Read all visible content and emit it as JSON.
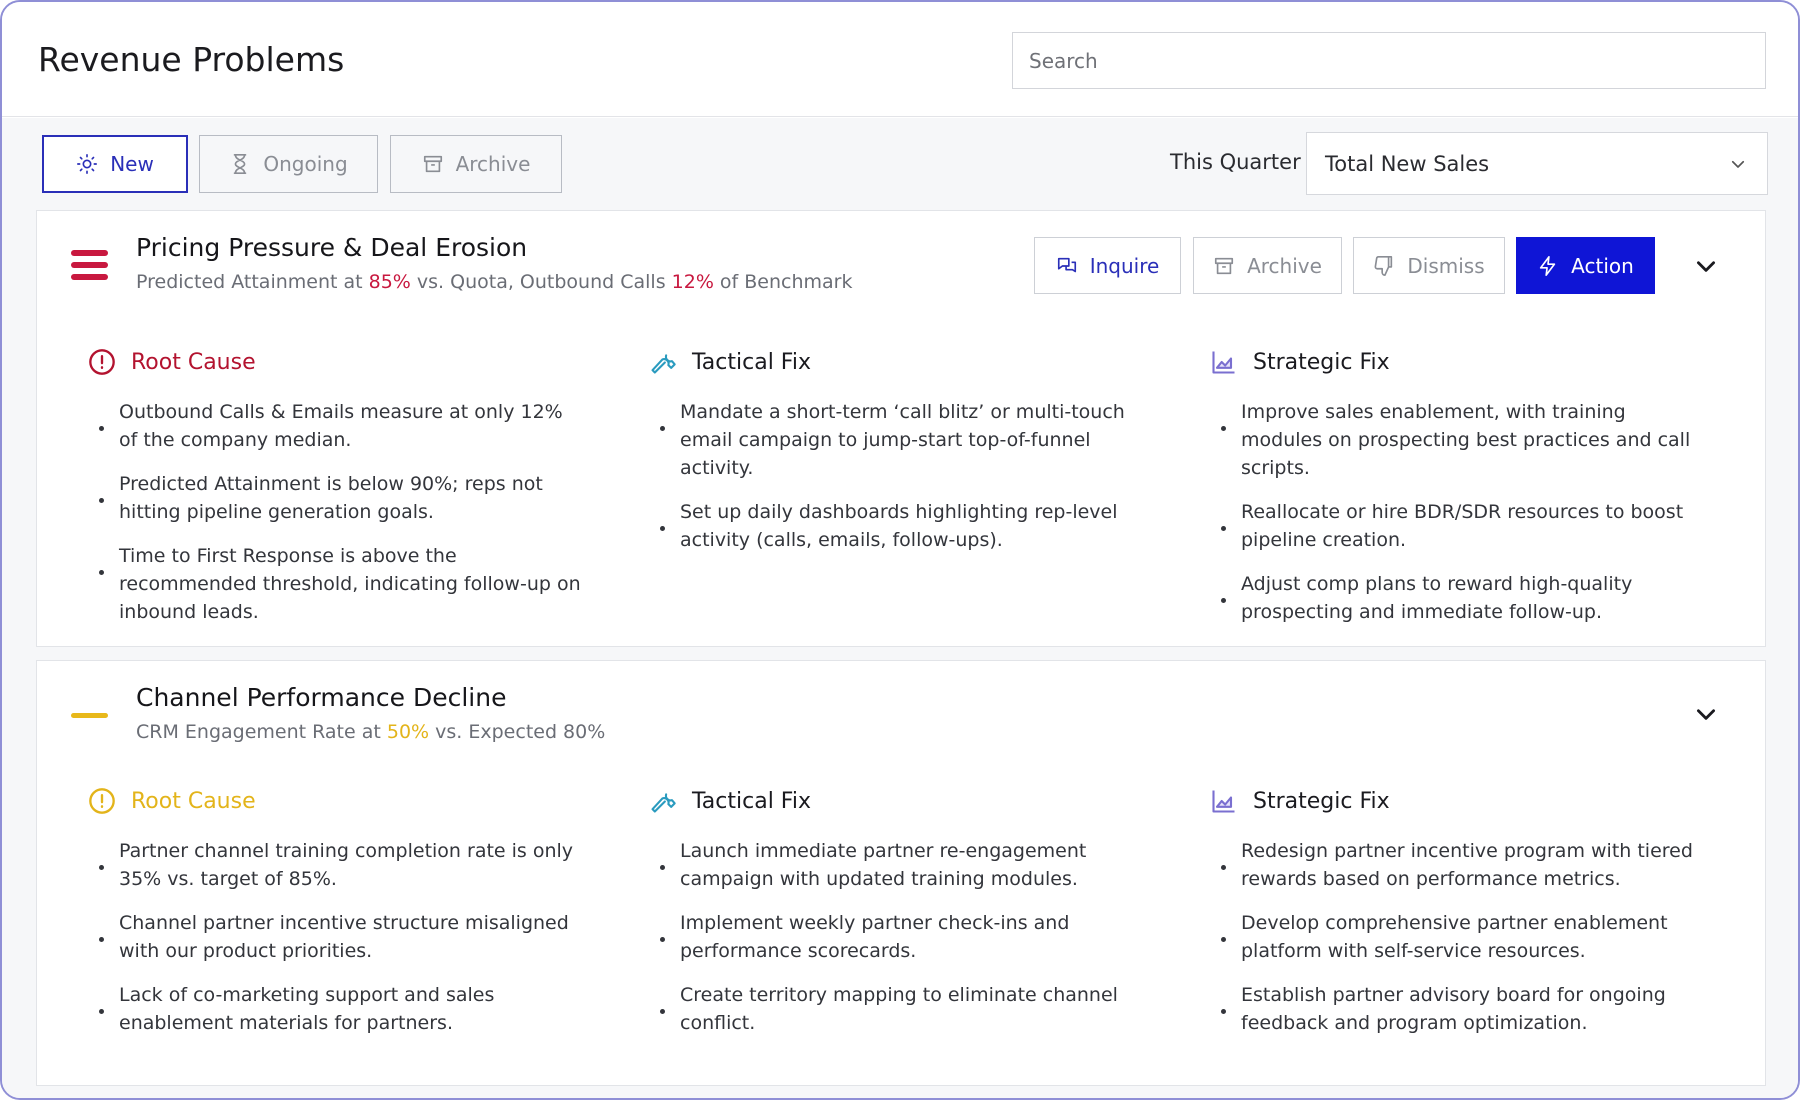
{
  "header": {
    "title": "Revenue Problems",
    "search_placeholder": "Search"
  },
  "tabs": [
    {
      "label": "New",
      "icon": "sun-icon",
      "active": true
    },
    {
      "label": "Ongoing",
      "icon": "hourglass-icon",
      "active": false
    },
    {
      "label": "Archive",
      "icon": "archive-icon",
      "active": false
    }
  ],
  "filters": {
    "period": "This Quarter",
    "metric_selected": "Total New Sales"
  },
  "colors": {
    "accent": "#0f15d6",
    "severity_high": "#c8183f",
    "severity_medium": "#e8b81a",
    "tactical_icon": "#2a9bbf",
    "strategic_icon": "#7a6fd0"
  },
  "problems": [
    {
      "severity": "high",
      "title": "Pricing Pressure & Deal Erosion",
      "subtitle": {
        "p1": "Predicted Attainment at ",
        "v1": "85%",
        "p2": " vs. Quota, Outbound Calls ",
        "v2": "12%",
        "p3": " of Benchmark"
      },
      "actions": {
        "inquire": "Inquire",
        "archive": "Archive",
        "dismiss": "Dismiss",
        "action": "Action"
      },
      "root_cause": {
        "title": "Root Cause",
        "items": [
          "Outbound Calls & Emails measure at only 12% of the company median.",
          "Predicted Attainment is below 90%; reps not hitting pipeline generation goals.",
          "Time to First Response is above the recommended threshold, indicating follow-up on inbound leads."
        ]
      },
      "tactical_fix": {
        "title": "Tactical Fix",
        "items": [
          "Mandate a short-term ‘call blitz’ or multi-touch email campaign to jump-start top-of-funnel activity.",
          "Set up daily dashboards highlighting rep-level activity (calls, emails, follow-ups)."
        ]
      },
      "strategic_fix": {
        "title": "Strategic Fix",
        "items": [
          "Improve sales enablement, with training modules on prospecting best practices and call scripts.",
          "Reallocate or hire BDR/SDR resources to boost pipeline creation.",
          "Adjust comp plans to reward high-quality prospecting and immediate follow-up."
        ]
      }
    },
    {
      "severity": "medium",
      "title": "Channel Performance Decline",
      "subtitle": {
        "p1": "CRM Engagement Rate at ",
        "v1": "50%",
        "p2": " vs. Expected 80%"
      },
      "root_cause": {
        "title": "Root Cause",
        "items": [
          "Partner channel training completion rate is only 35% vs. target of 85%.",
          "Channel partner incentive structure misaligned with our product priorities.",
          "Lack of co-marketing support and sales enablement materials for partners."
        ]
      },
      "tactical_fix": {
        "title": "Tactical Fix",
        "items": [
          "Launch immediate partner re-engagement campaign with updated training modules.",
          "Implement weekly partner check-ins and performance scorecards.",
          "Create territory mapping to eliminate channel conflict."
        ]
      },
      "strategic_fix": {
        "title": "Strategic Fix",
        "items": [
          "Redesign partner incentive program with tiered rewards based on performance metrics.",
          "Develop comprehensive partner enablement platform with self-service resources.",
          "Establish partner advisory board for ongoing feedback and program optimization."
        ]
      }
    }
  ]
}
